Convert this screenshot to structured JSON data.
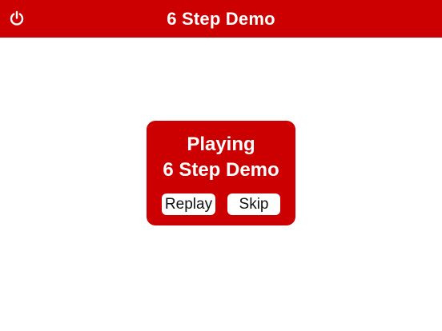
{
  "header": {
    "title": "6 Step Demo",
    "power_icon": "power-icon"
  },
  "dialog": {
    "line1": "Playing",
    "line2": "6 Step Demo",
    "replay_label": "Replay",
    "skip_label": "Skip"
  },
  "colors": {
    "brand_red": "#cc0000",
    "background": "#ffffff",
    "button_text": "#111111"
  }
}
